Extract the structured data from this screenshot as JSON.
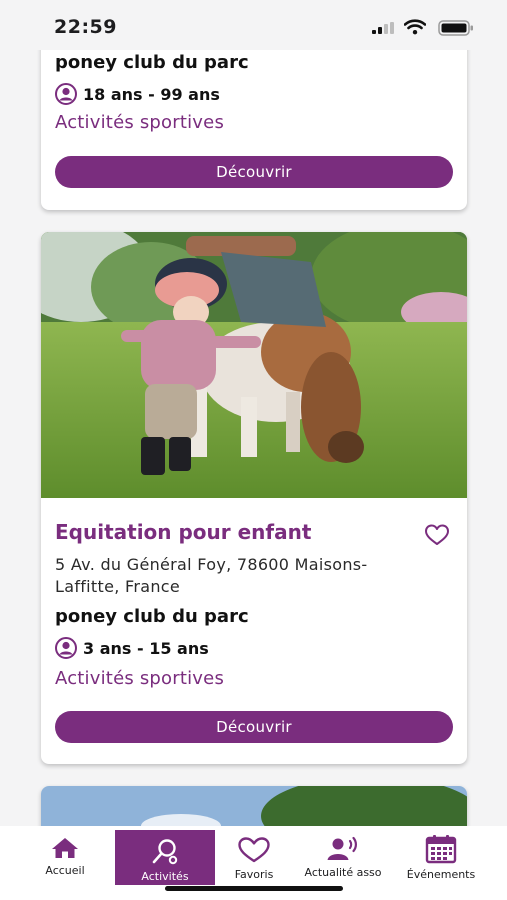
{
  "status_bar": {
    "time": "22:59",
    "icons": [
      "signal-icon",
      "wifi-icon",
      "battery-icon"
    ]
  },
  "colors": {
    "brand": "#7a2d7e",
    "background": "#f4f4f5"
  },
  "activities": [
    {
      "title": "",
      "address": "",
      "club": "poney club du parc",
      "age_range": "18 ans - 99 ans",
      "category": "Activités sportives",
      "button_label": "Découvrir"
    },
    {
      "title": "Equitation pour enfant",
      "address": "5 Av. du Général Foy, 78600 Maisons-Laffitte, France",
      "club": "poney club du parc",
      "age_range": "3 ans - 15 ans",
      "category": "Activités sportives",
      "button_label": "Découvrir",
      "image": "child-with-pony-photo",
      "favorite_icon": "heart-outline-icon"
    }
  ],
  "bottom_nav": {
    "items": [
      {
        "label": "Accueil",
        "icon": "home-icon"
      },
      {
        "label": "Activités",
        "icon": "search-activity-icon",
        "active": true
      },
      {
        "label": "Favoris",
        "icon": "heart-icon"
      },
      {
        "label": "Actualité asso",
        "icon": "announcement-icon"
      },
      {
        "label": "Événements",
        "icon": "calendar-icon"
      }
    ]
  }
}
